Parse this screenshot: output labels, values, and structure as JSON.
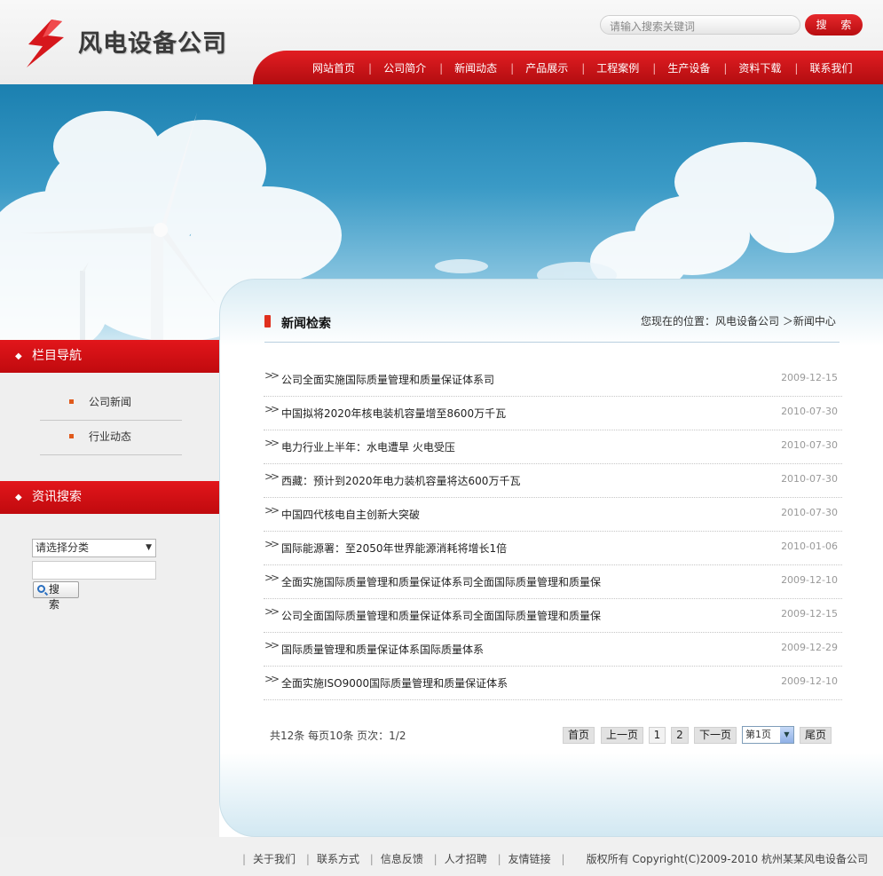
{
  "brand": {
    "name": "风电设备公司"
  },
  "header_search": {
    "placeholder": "请输入搜索关键词",
    "button_label": "搜 索"
  },
  "nav": {
    "items": [
      "网站首页",
      "公司简介",
      "新闻动态",
      "产品展示",
      "工程案例",
      "生产设备",
      "资料下载",
      "联系我们"
    ]
  },
  "sidebar": {
    "nav_title": "栏目导航",
    "nav_items": [
      "公司新闻",
      "行业动态"
    ],
    "search_title": "资讯搜索",
    "category_select": "请选择分类",
    "search_button": "搜 索"
  },
  "content": {
    "title": "新闻检索",
    "breadcrumb": "您现在的位置：风电设备公司 ＞新闻中心",
    "news": [
      {
        "title": "公司全面实施国际质量管理和质量保证体系司",
        "date": "2009-12-15"
      },
      {
        "title": "中国拟将2020年核电装机容量增至8600万千瓦",
        "date": "2010-07-30"
      },
      {
        "title": "电力行业上半年：水电遭旱 火电受压",
        "date": "2010-07-30"
      },
      {
        "title": "西藏：预计到2020年电力装机容量将达600万千瓦",
        "date": "2010-07-30"
      },
      {
        "title": "中国四代核电自主创新大突破",
        "date": "2010-07-30"
      },
      {
        "title": "国际能源署：至2050年世界能源消耗将增长1倍",
        "date": "2010-01-06"
      },
      {
        "title": "全面实施国际质量管理和质量保证体系司全面国际质量管理和质量保",
        "date": "2009-12-10"
      },
      {
        "title": "公司全面国际质量管理和质量保证体系司全面国际质量管理和质量保",
        "date": "2009-12-15"
      },
      {
        "title": "国际质量管理和质量保证体系国际质量体系",
        "date": "2009-12-29"
      },
      {
        "title": "全面实施ISO9000国际质量管理和质量保证体系",
        "date": "2009-12-10"
      }
    ],
    "pager": {
      "info": "共12条  每页10条  页次：1/2",
      "first": "首页",
      "prev": "上一页",
      "page1": "1",
      "page2": "2",
      "next": "下一页",
      "select": "第1页",
      "last": "尾页"
    }
  },
  "footer": {
    "links": [
      "关于我们",
      "联系方式",
      "信息反馈",
      "人才招聘",
      "友情链接"
    ],
    "copyright": "版权所有  Copyright(C)2009-2010 杭州某某风电设备公司"
  },
  "colors": {
    "brand_red": "#d0161b",
    "sky_blue": "#1b80b0"
  }
}
